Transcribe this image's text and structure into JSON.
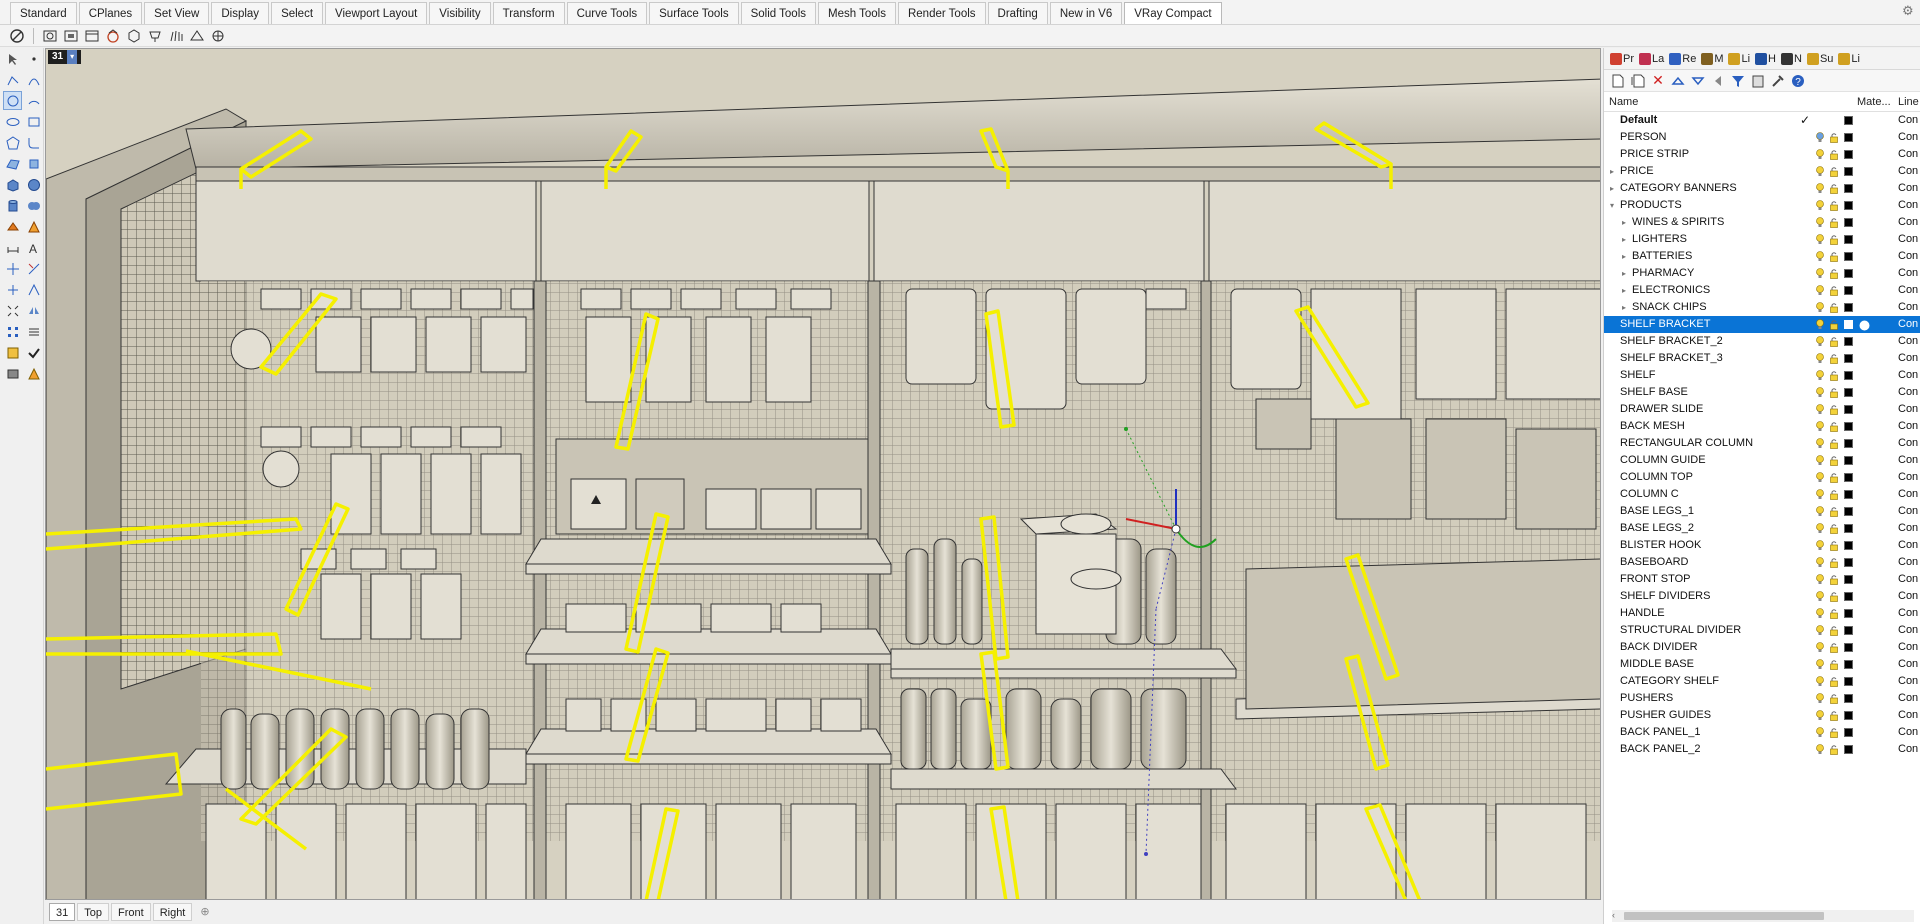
{
  "tabs": [
    "Standard",
    "CPlanes",
    "Set View",
    "Display",
    "Select",
    "Viewport Layout",
    "Visibility",
    "Transform",
    "Curve Tools",
    "Surface Tools",
    "Solid Tools",
    "Mesh Tools",
    "Render Tools",
    "Drafting",
    "New in V6",
    "VRay Compact"
  ],
  "active_tab": "VRay Compact",
  "viewport": {
    "title": "31",
    "tabs": [
      "31",
      "Top",
      "Front",
      "Right"
    ],
    "active_tab": "31",
    "add_tab_icon": "plus-icon"
  },
  "panel": {
    "tabs": [
      {
        "label": "Pr",
        "icon": "properties-icon",
        "color": "#d04030"
      },
      {
        "label": "La",
        "icon": "layers-icon",
        "color": "#c03050"
      },
      {
        "label": "Re",
        "icon": "render-icon",
        "color": "#3060c0"
      },
      {
        "label": "M",
        "icon": "materials-icon",
        "color": "#806020"
      },
      {
        "label": "Li",
        "icon": "libraries-icon",
        "color": "#d0a020"
      },
      {
        "label": "H",
        "icon": "help-icon",
        "color": "#2050a0"
      },
      {
        "label": "N",
        "icon": "named-views-icon",
        "color": "#333333"
      },
      {
        "label": "Su",
        "icon": "sun-icon",
        "color": "#d0a020"
      },
      {
        "label": "Li",
        "icon": "lights-icon",
        "color": "#d0a020"
      }
    ],
    "columns": {
      "name": "Name",
      "material": "Mate...",
      "linetype": "Line"
    },
    "layers": [
      {
        "name": "Default",
        "bold": true,
        "current": true,
        "indent": 0,
        "arrow": "",
        "color": "#000000",
        "linetype": "Con"
      },
      {
        "name": "PERSON",
        "indent": 0,
        "arrow": "",
        "color": "#000000",
        "linetype": "Con",
        "bulb": "blue"
      },
      {
        "name": "PRICE STRIP",
        "indent": 0,
        "arrow": "",
        "color": "#000000",
        "linetype": "Con"
      },
      {
        "name": "PRICE",
        "indent": 0,
        "arrow": "›",
        "color": "#000000",
        "linetype": "Con"
      },
      {
        "name": "CATEGORY BANNERS",
        "indent": 0,
        "arrow": "›",
        "color": "#000000",
        "linetype": "Con"
      },
      {
        "name": "PRODUCTS",
        "indent": 0,
        "arrow": "⌄",
        "color": "#000000",
        "linetype": "Con"
      },
      {
        "name": "WINES & SPIRITS",
        "indent": 1,
        "arrow": "›",
        "color": "#000000",
        "linetype": "Con"
      },
      {
        "name": "LIGHTERS",
        "indent": 1,
        "arrow": "›",
        "color": "#000000",
        "linetype": "Con"
      },
      {
        "name": "BATTERIES",
        "indent": 1,
        "arrow": "›",
        "color": "#000000",
        "linetype": "Con"
      },
      {
        "name": "PHARMACY",
        "indent": 1,
        "arrow": "›",
        "color": "#000000",
        "linetype": "Con"
      },
      {
        "name": "ELECTRONICS",
        "indent": 1,
        "arrow": "›",
        "color": "#000000",
        "linetype": "Con"
      },
      {
        "name": "SNACK CHIPS",
        "indent": 1,
        "arrow": "›",
        "color": "#000000",
        "linetype": "Con"
      },
      {
        "name": "SHELF BRACKET",
        "indent": 0,
        "arrow": "",
        "color": "#ffffff",
        "linetype": "Con",
        "selected": true
      },
      {
        "name": "SHELF BRACKET_2",
        "indent": 0,
        "arrow": "",
        "color": "#000000",
        "linetype": "Con"
      },
      {
        "name": "SHELF BRACKET_3",
        "indent": 0,
        "arrow": "",
        "color": "#000000",
        "linetype": "Con"
      },
      {
        "name": "SHELF",
        "indent": 0,
        "arrow": "",
        "color": "#000000",
        "linetype": "Con"
      },
      {
        "name": "SHELF BASE",
        "indent": 0,
        "arrow": "",
        "color": "#000000",
        "linetype": "Con"
      },
      {
        "name": "DRAWER SLIDE",
        "indent": 0,
        "arrow": "",
        "color": "#000000",
        "linetype": "Con"
      },
      {
        "name": "BACK MESH",
        "indent": 0,
        "arrow": "",
        "color": "#000000",
        "linetype": "Con"
      },
      {
        "name": "RECTANGULAR COLUMN",
        "indent": 0,
        "arrow": "",
        "color": "#000000",
        "linetype": "Con"
      },
      {
        "name": "COLUMN GUIDE",
        "indent": 0,
        "arrow": "",
        "color": "#000000",
        "linetype": "Con"
      },
      {
        "name": "COLUMN TOP",
        "indent": 0,
        "arrow": "",
        "color": "#000000",
        "linetype": "Con"
      },
      {
        "name": "COLUMN C",
        "indent": 0,
        "arrow": "",
        "color": "#000000",
        "linetype": "Con"
      },
      {
        "name": "BASE LEGS_1",
        "indent": 0,
        "arrow": "",
        "color": "#000000",
        "linetype": "Con"
      },
      {
        "name": "BASE LEGS_2",
        "indent": 0,
        "arrow": "",
        "color": "#000000",
        "linetype": "Con"
      },
      {
        "name": "BLISTER HOOK",
        "indent": 0,
        "arrow": "",
        "color": "#000000",
        "linetype": "Con"
      },
      {
        "name": "BASEBOARD",
        "indent": 0,
        "arrow": "",
        "color": "#000000",
        "linetype": "Con"
      },
      {
        "name": "FRONT STOP",
        "indent": 0,
        "arrow": "",
        "color": "#000000",
        "linetype": "Con"
      },
      {
        "name": "SHELF DIVIDERS",
        "indent": 0,
        "arrow": "",
        "color": "#000000",
        "linetype": "Con"
      },
      {
        "name": "HANDLE",
        "indent": 0,
        "arrow": "",
        "color": "#000000",
        "linetype": "Con"
      },
      {
        "name": "STRUCTURAL DIVIDER",
        "indent": 0,
        "arrow": "",
        "color": "#000000",
        "linetype": "Con"
      },
      {
        "name": "BACK DIVIDER",
        "indent": 0,
        "arrow": "",
        "color": "#000000",
        "linetype": "Con"
      },
      {
        "name": "MIDDLE BASE",
        "indent": 0,
        "arrow": "",
        "color": "#000000",
        "linetype": "Con"
      },
      {
        "name": "CATEGORY SHELF",
        "indent": 0,
        "arrow": "",
        "color": "#000000",
        "linetype": "Con"
      },
      {
        "name": "PUSHERS",
        "indent": 0,
        "arrow": "",
        "color": "#000000",
        "linetype": "Con"
      },
      {
        "name": "PUSHER GUIDES",
        "indent": 0,
        "arrow": "",
        "color": "#000000",
        "linetype": "Con"
      },
      {
        "name": "BACK PANEL_1",
        "indent": 0,
        "arrow": "",
        "color": "#000000",
        "linetype": "Con"
      },
      {
        "name": "BACK PANEL_2",
        "indent": 0,
        "arrow": "",
        "color": "#000000",
        "linetype": "Con"
      }
    ]
  },
  "colors": {
    "selection": "#0a74d6",
    "bracket_highlight": "#f5f000",
    "viewport_bg": "#d8d3c4"
  }
}
